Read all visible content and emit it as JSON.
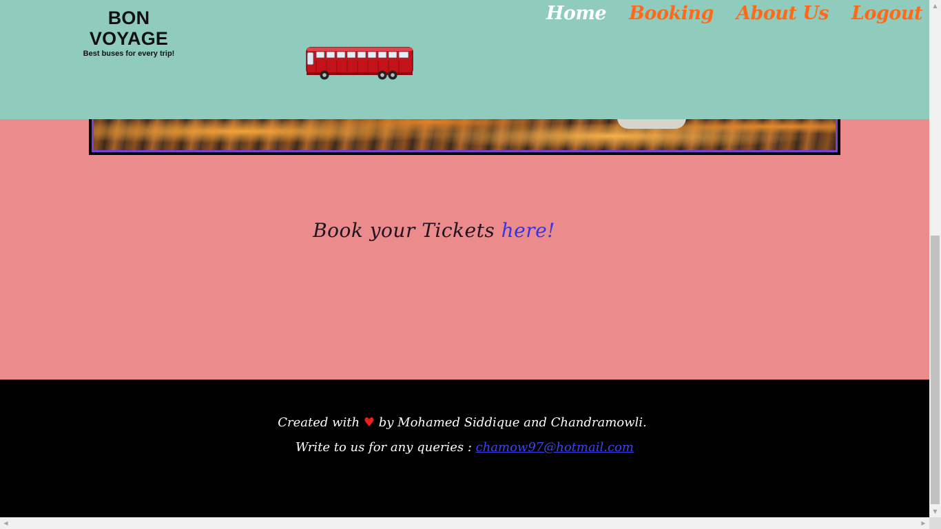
{
  "brand": {
    "title": "BON VOYAGE",
    "tagline": "Best buses for every trip!"
  },
  "nav": {
    "items": [
      "Home",
      "Booking",
      "About Us",
      "Logout"
    ],
    "active": "Home"
  },
  "main": {
    "book_text": "Book your Tickets ",
    "book_link": "here!"
  },
  "footer": {
    "created_prefix": "Created with",
    "heart": "♥",
    "created_suffix": " by Mohamed Siddique and Chandramowli.",
    "contact_prefix": "Write to us for any queries : ",
    "email": "chamow97@hotmail.com"
  },
  "colors": {
    "header": "#8fccbe",
    "body": "#ec8b8b",
    "footer": "#000000",
    "nav_link": "#ff6a1a",
    "nav_active": "#ffffff",
    "link": "#3434e8"
  }
}
